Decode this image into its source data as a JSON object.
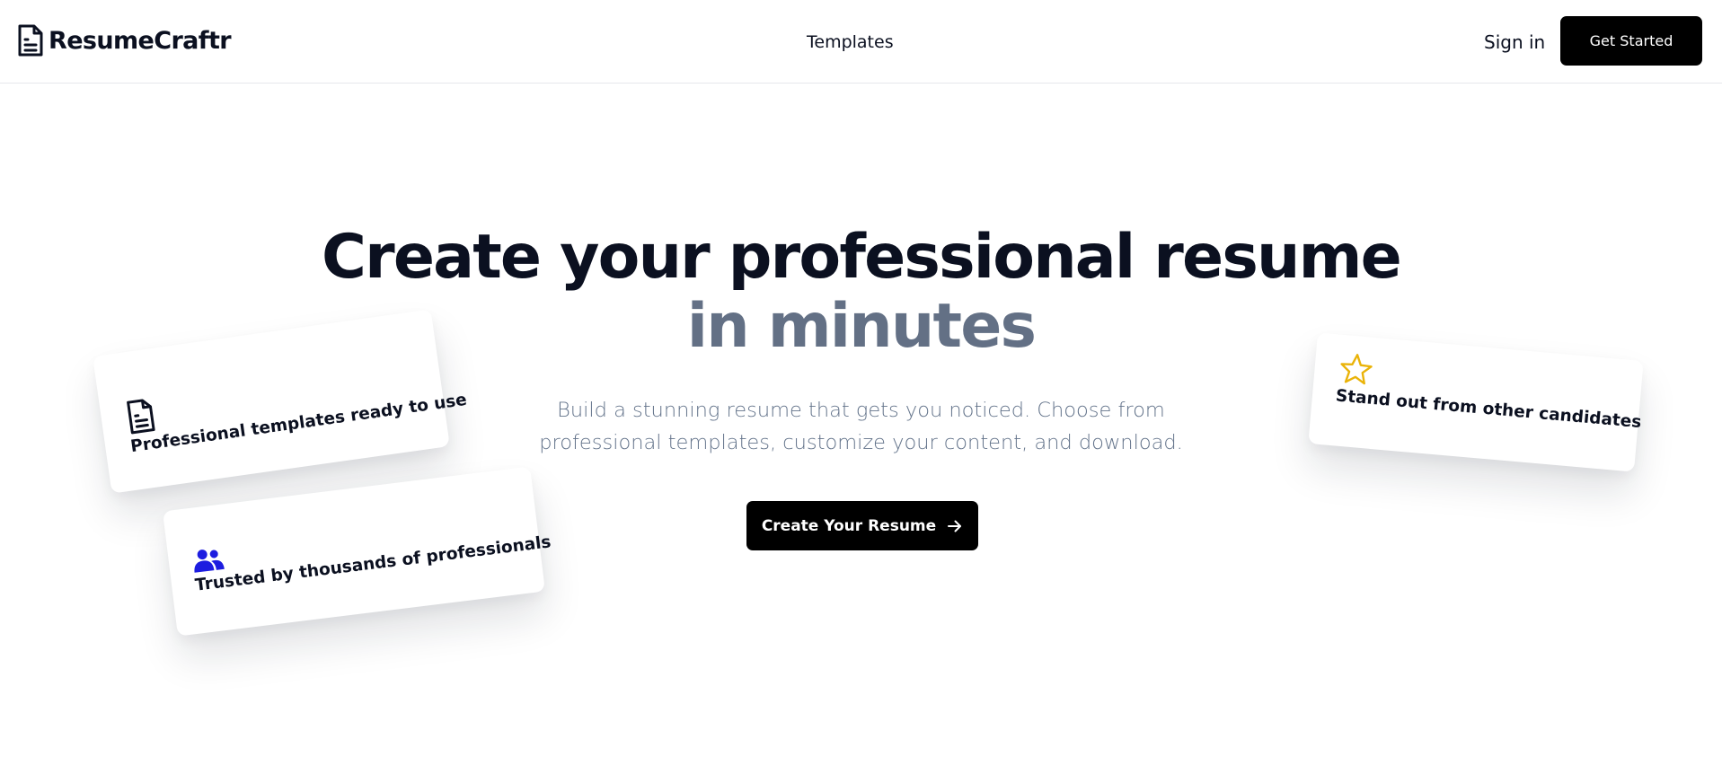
{
  "header": {
    "brand_name": "ResumeCraftr",
    "nav_templates": "Templates",
    "sign_in": "Sign in",
    "get_started": "Get Started"
  },
  "hero": {
    "title_line1": "Create your professional resume",
    "title_line2": "in minutes",
    "subtitle_line1": "Build a stunning resume that gets you noticed. Choose from",
    "subtitle_line2": "professional templates, customize your content, and download.",
    "cta_label": "Create Your Resume"
  },
  "feature_cards": {
    "templates": {
      "icon": "document-icon",
      "text": "Professional templates ready to use"
    },
    "trusted": {
      "icon": "users-icon",
      "text": "Trusted by thousands of professionals"
    },
    "standout": {
      "icon": "star-icon",
      "text": "Stand out from other candidates"
    }
  },
  "colors": {
    "primary_text": "#0b1020",
    "muted_heading": "#637085",
    "subtitle": "#64748b",
    "button_bg": "#000000",
    "users_icon": "#1d1de0",
    "star_icon": "#eab308",
    "divider": "#e6e8ec"
  }
}
